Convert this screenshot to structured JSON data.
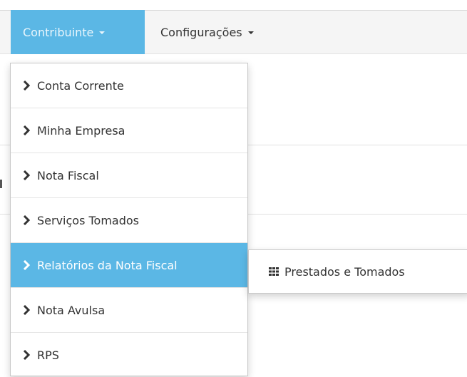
{
  "navbar": {
    "items": [
      {
        "label": "Contribuinte",
        "icon": "caret-down-icon"
      },
      {
        "label": "Configurações",
        "icon": "caret-down-icon"
      }
    ]
  },
  "dropdown": {
    "items": [
      {
        "label": "Conta Corrente",
        "icon": "chevron-right-icon"
      },
      {
        "label": "Minha Empresa",
        "icon": "chevron-right-icon"
      },
      {
        "label": "Nota Fiscal",
        "icon": "chevron-right-icon"
      },
      {
        "label": "Serviços Tomados",
        "icon": "chevron-right-icon"
      },
      {
        "label": "Relatórios da Nota Fiscal",
        "icon": "chevron-right-icon",
        "active": true
      },
      {
        "label": "Nota Avulsa",
        "icon": "chevron-right-icon"
      },
      {
        "label": "RPS",
        "icon": "chevron-right-icon"
      }
    ]
  },
  "submenu": {
    "items": [
      {
        "label": "Prestados e Tomados",
        "icon": "grid-icon"
      }
    ]
  },
  "colors": {
    "accent": "#5bb7e5",
    "navbar_bg": "#f5f5f5"
  }
}
